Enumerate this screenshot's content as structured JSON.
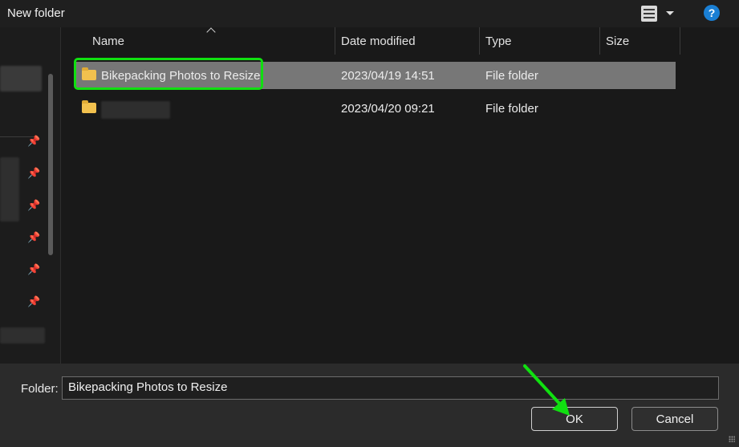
{
  "window": {
    "title": "New folder"
  },
  "toolbar": {
    "view_icon": "details-view-icon",
    "help_label": "?"
  },
  "columns": [
    "Name",
    "Date modified",
    "Type",
    "Size"
  ],
  "rows": [
    {
      "name": "Bikepacking Photos to Resize",
      "date": "2023/04/19 14:51",
      "type": "File folder",
      "size": ""
    },
    {
      "name": "",
      "date": "2023/04/20 09:21",
      "type": "File folder",
      "size": ""
    }
  ],
  "footer": {
    "folder_label": "Folder:",
    "folder_value": "Bikepacking Photos to Resize",
    "ok_label": "OK",
    "cancel_label": "Cancel"
  },
  "colors": {
    "highlight": "#10e010",
    "selected_row": "#777777",
    "help": "#1a7fd4",
    "folder": "#f2c14e"
  }
}
